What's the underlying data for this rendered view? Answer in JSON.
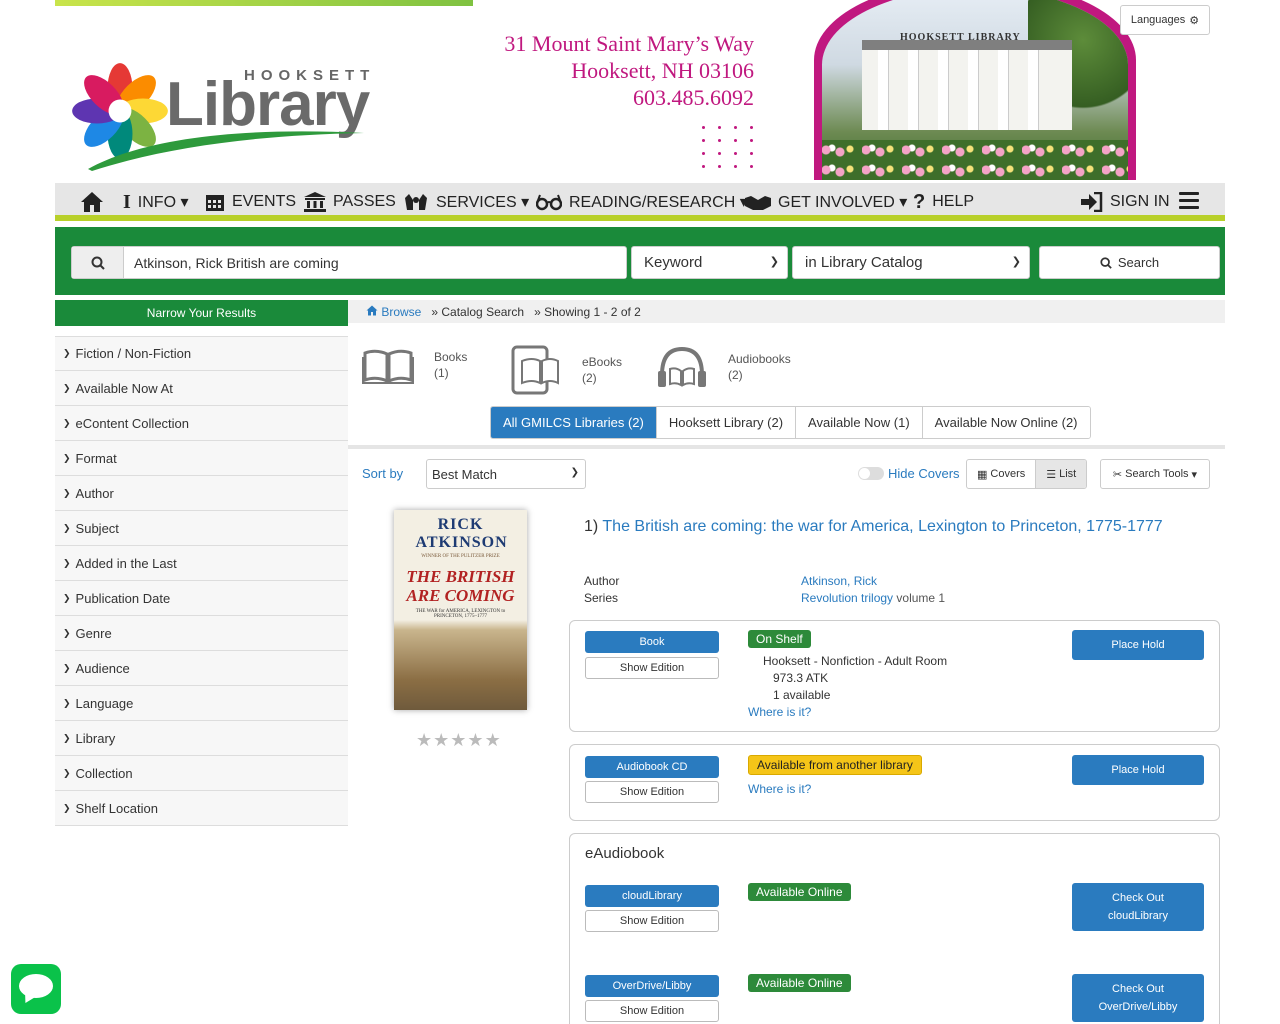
{
  "header": {
    "logo_word_small": "HOOKSETT",
    "logo_word_large": "Library",
    "address_line1": "31 Mount Saint Mary’s Way",
    "address_line2": "Hooksett, NH  03106",
    "phone": "603.485.6092",
    "photo_sign": "HOOKSETT  LIBRARY",
    "languages_label": "Languages",
    "colors": {
      "accent_magenta": "#c0187f",
      "brand_green": "#1a8a3a",
      "nav_lime": "#b8d02a",
      "link_blue": "#2a7bbf"
    }
  },
  "nav": {
    "items": [
      {
        "label": "",
        "icon": "home-icon"
      },
      {
        "label": "INFO ▾",
        "icon": "info-icon"
      },
      {
        "label": "EVENTS",
        "icon": "calendar-icon"
      },
      {
        "label": "PASSES",
        "icon": "museum-icon"
      },
      {
        "label": "SERVICES ▾",
        "icon": "hands-icon"
      },
      {
        "label": "READING/RESEARCH ▾",
        "icon": "glasses-icon"
      },
      {
        "label": "GET INVOLVED ▾",
        "icon": "handshake-icon"
      },
      {
        "label": "HELP",
        "icon": "question-icon"
      }
    ],
    "sign_in": "SIGN IN"
  },
  "search": {
    "query": "Atkinson, Rick British are coming",
    "type": "Keyword",
    "scope": "in Library Catalog",
    "button": "Search"
  },
  "sidebar": {
    "title": "Narrow Your Results",
    "facets": [
      "Fiction / Non-Fiction",
      "Available Now At",
      "eContent Collection",
      "Format",
      "Author",
      "Subject",
      "Added in the Last",
      "Publication Date",
      "Genre",
      "Audience",
      "Language",
      "Library",
      "Collection",
      "Shelf Location"
    ]
  },
  "breadcrumb": {
    "browse": "Browse",
    "catalog": "» Catalog Search",
    "showing": "» Showing 1 - 2 of 2"
  },
  "formats": [
    {
      "name": "Books",
      "count": "(1)"
    },
    {
      "name": "eBooks",
      "count": "(2)"
    },
    {
      "name": "Audiobooks",
      "count": "(2)"
    }
  ],
  "scopes": [
    {
      "label": "All GMILCS Libraries (2)",
      "active": true
    },
    {
      "label": "Hooksett Library (2)",
      "active": false
    },
    {
      "label": "Available Now (1)",
      "active": false
    },
    {
      "label": "Available Now Online (2)",
      "active": false
    }
  ],
  "toolbar": {
    "sort_label": "Sort by",
    "sort_value": "Best Match",
    "hide_covers": "Hide Covers",
    "covers": "Covers",
    "list": "List",
    "search_tools": "Search Tools"
  },
  "result": {
    "index": "1)",
    "title": "The British are coming: the war for America, Lexington to Princeton, 1775-1777",
    "author_label": "Author",
    "author": "Atkinson, Rick",
    "series_label": "Series",
    "series": "Revolution trilogy",
    "series_volume": "volume 1",
    "cover": {
      "author": "RICK ATKINSON",
      "tagline": "WINNER OF THE PULITZER PRIZE",
      "title": "THE BRITISH ARE COMING",
      "subtitle": "THE WAR for AMERICA, LEXINGTON to PRINCETON, 1775–1777"
    },
    "rating_stars": 0,
    "editions": [
      {
        "format": "Book",
        "show_edition": "Show Edition",
        "status": "On Shelf",
        "location": "Hooksett - Nonfiction - Adult Room",
        "call_number": "973.3 ATK",
        "available": "1 available",
        "where": "Where is it?",
        "action": "Place Hold"
      },
      {
        "format": "Audiobook CD",
        "show_edition": "Show Edition",
        "status": "Available from another library",
        "where": "Where is it?",
        "action": "Place Hold"
      }
    ],
    "eaudiobook": {
      "heading": "eAudiobook",
      "items": [
        {
          "format": "cloudLibrary",
          "show_edition": "Show Edition",
          "status": "Available Online",
          "action_line1": "Check Out",
          "action_line2": "cloudLibrary"
        },
        {
          "format": "OverDrive/Libby",
          "show_edition": "Show Edition",
          "status": "Available Online",
          "action_line1": "Check Out",
          "action_line2": "OverDrive/Libby"
        }
      ]
    }
  }
}
